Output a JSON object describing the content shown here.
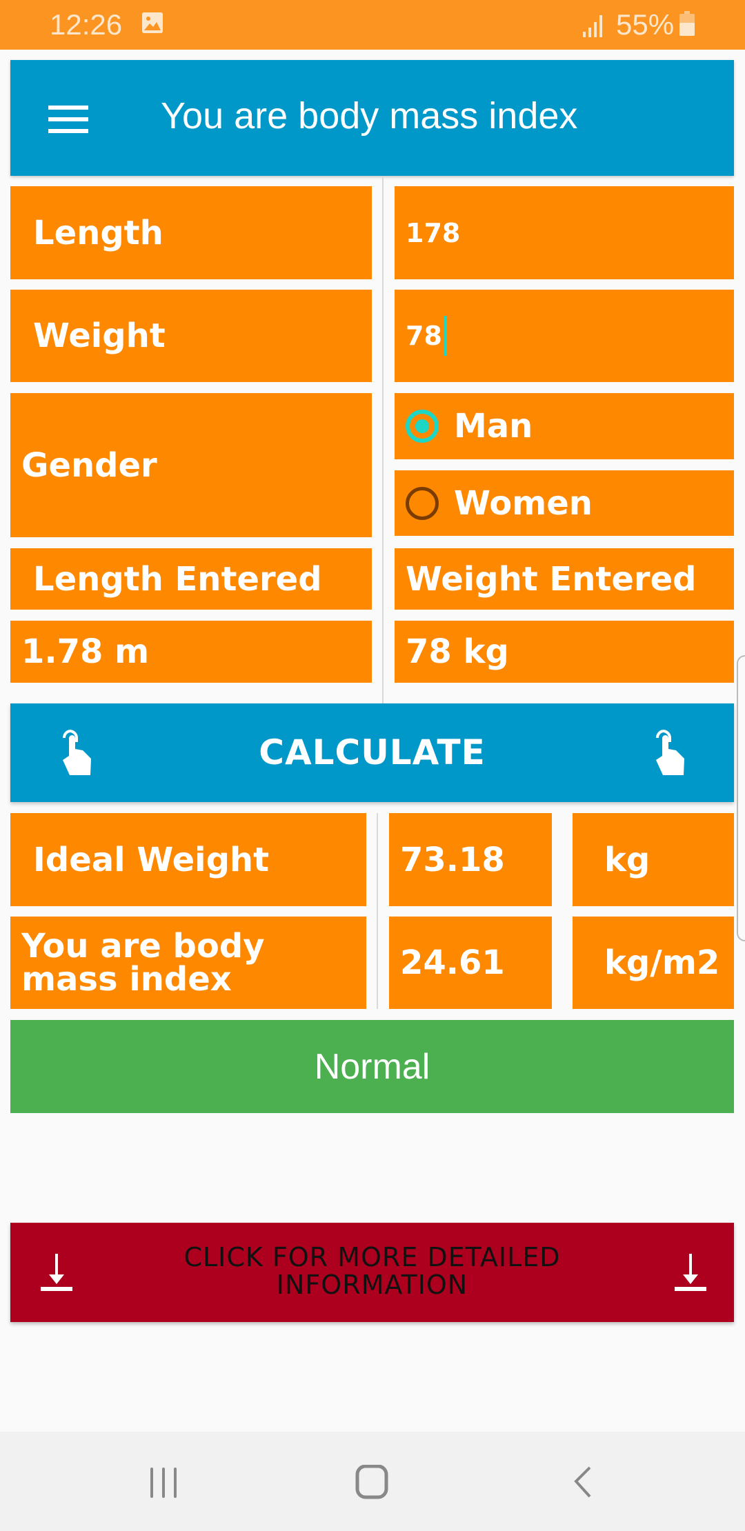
{
  "status_bar": {
    "time": "12:26",
    "battery": "55%",
    "icons": [
      "image-icon",
      "signal-icon",
      "battery-icon"
    ]
  },
  "app_bar": {
    "title": "You are body mass index",
    "menu_icon": "hamburger-menu-icon"
  },
  "inputs": {
    "length_label": "Length",
    "length_value": "178",
    "weight_label": "Weight",
    "weight_value": "78",
    "gender_label": "Gender",
    "gender_options": [
      {
        "label": "Man",
        "selected": true
      },
      {
        "label": "Women",
        "selected": false
      }
    ]
  },
  "entered": {
    "length_label": "Length Entered",
    "length_value": "1.78 m",
    "weight_label": "Weight Entered",
    "weight_value": "78 kg"
  },
  "calculate_button": {
    "label": "CALCULATE",
    "icon": "tap-hand-icon"
  },
  "results": {
    "rows": [
      {
        "label": "Ideal Weight",
        "value": "73.18",
        "unit": "kg"
      },
      {
        "label": "You are body mass index",
        "value": "24.61",
        "unit": "kg/m2"
      }
    ],
    "category": "Normal"
  },
  "colors": {
    "orange": "#fe8800",
    "blue": "#0098c9",
    "green": "#4caf50",
    "red": "#ad001e",
    "status_bar": "#fb9420",
    "accent": "#1dd6c4"
  },
  "more_button": {
    "label": "CLICK FOR MORE DETAILED INFORMATION",
    "icon": "download-icon"
  },
  "nav_bar": {
    "buttons": [
      "recent-apps",
      "home",
      "back"
    ]
  }
}
